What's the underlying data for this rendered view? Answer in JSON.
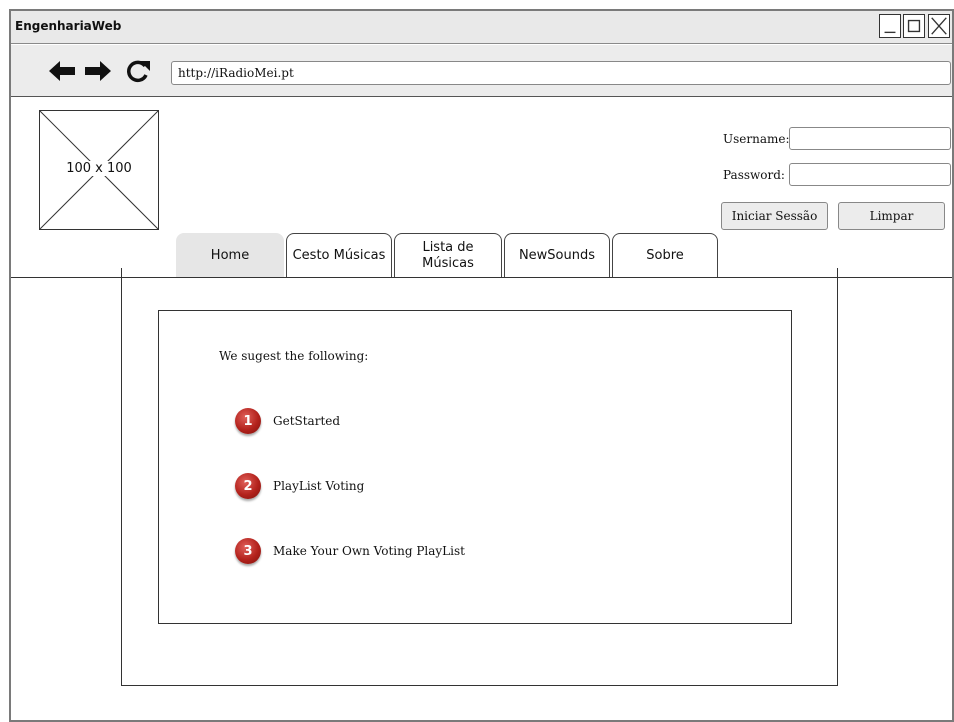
{
  "window": {
    "title": "EngenhariaWeb"
  },
  "browser": {
    "url": "http://iRadioMei.pt",
    "icons": [
      "arrow-left-icon",
      "arrow-right-icon",
      "reload-icon"
    ]
  },
  "header": {
    "logo_placeholder": "100 x 100",
    "login": {
      "username_label": "Username:",
      "password_label": "Password:",
      "username_value": "",
      "password_value": "",
      "login_button": "Iniciar Sessão",
      "clear_button": "Limpar"
    }
  },
  "tabs": [
    {
      "label": "Home",
      "active": true
    },
    {
      "label": "Cesto Músicas",
      "active": false
    },
    {
      "label": "Lista de Músicas",
      "active": false
    },
    {
      "label": "NewSounds",
      "active": false
    },
    {
      "label": "Sobre",
      "active": false
    }
  ],
  "main": {
    "intro": "We sugest the following:",
    "suggestions": [
      {
        "number": "1",
        "label": "GetStarted"
      },
      {
        "number": "2",
        "label": "PlayList Voting"
      },
      {
        "number": "3",
        "label": "Make Your Own Voting PlayList"
      }
    ]
  },
  "colors": {
    "badge": "#b3221c",
    "active_tab": "#e6e6e6",
    "chrome": "#ececec"
  }
}
